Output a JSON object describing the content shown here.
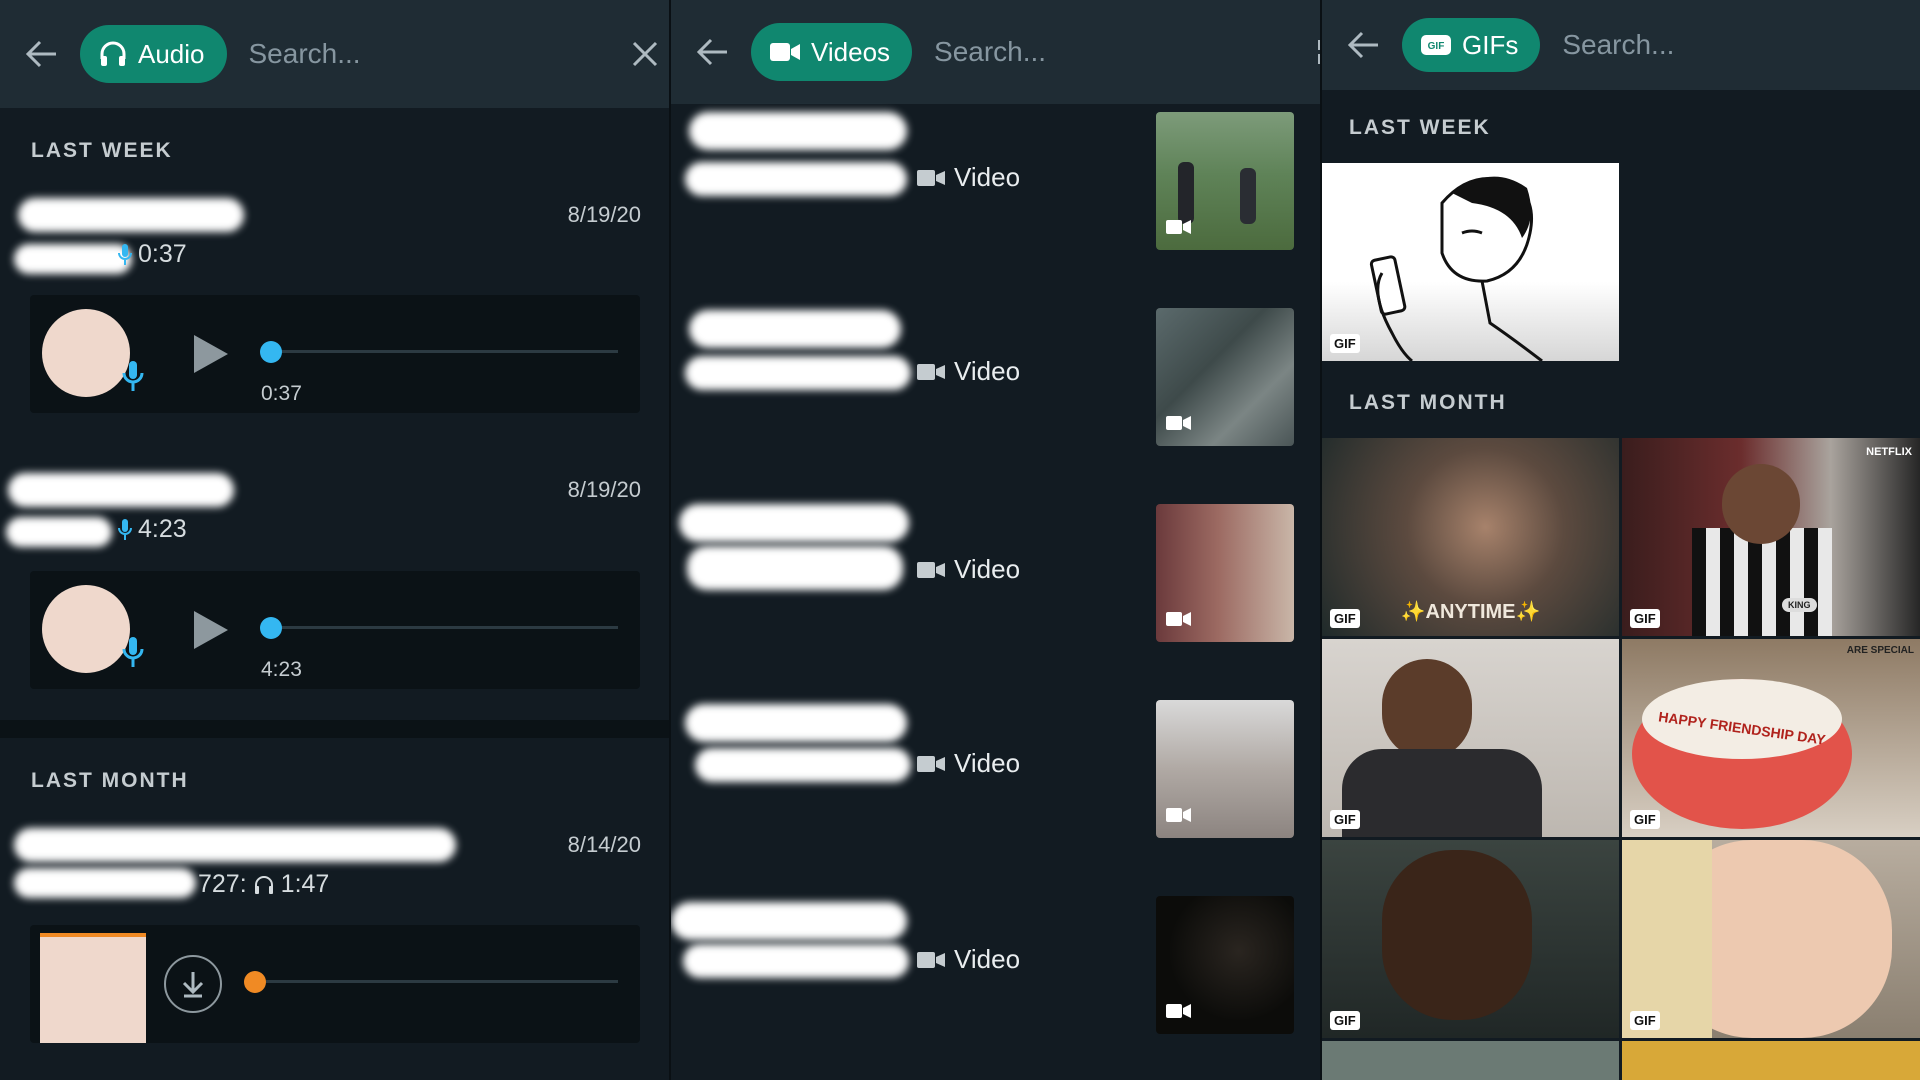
{
  "audio_panel": {
    "chip_label": "Audio",
    "search_placeholder": "Search...",
    "section_last_week": "LAST WEEK",
    "section_last_month": "LAST MONTH",
    "items": [
      {
        "date": "8/19/20",
        "meta_duration": "0:37",
        "player_duration": "0:37"
      },
      {
        "date": "8/19/20",
        "meta_duration": "4:23",
        "player_duration": "4:23"
      },
      {
        "date": "8/14/20",
        "meta_prefix": "727:",
        "meta_duration": "1:47"
      }
    ]
  },
  "video_panel": {
    "chip_label": "Videos",
    "search_placeholder": "Search...",
    "items": [
      {
        "type_label": "Video"
      },
      {
        "type_label": "Video"
      },
      {
        "type_label": "Video"
      },
      {
        "type_label": "Video"
      },
      {
        "type_label": "Video"
      }
    ]
  },
  "gif_panel": {
    "chip_label": "GIFs",
    "search_placeholder": "Search...",
    "section_last_week": "LAST WEEK",
    "section_last_month": "LAST MONTH",
    "badge": "GIF",
    "captions": {
      "anytime": "✨ANYTIME✨",
      "netflix": "NETFLIX",
      "cake": "HAPPY FRIENDSHIP DAY",
      "special": "ARE SPECIAL",
      "king": "KING"
    }
  },
  "colors": {
    "accent": "#10876f",
    "blue": "#34b7f1",
    "orange": "#f08a24",
    "panel_bg": "#121b22",
    "toolbar_bg": "#1f2c34"
  }
}
